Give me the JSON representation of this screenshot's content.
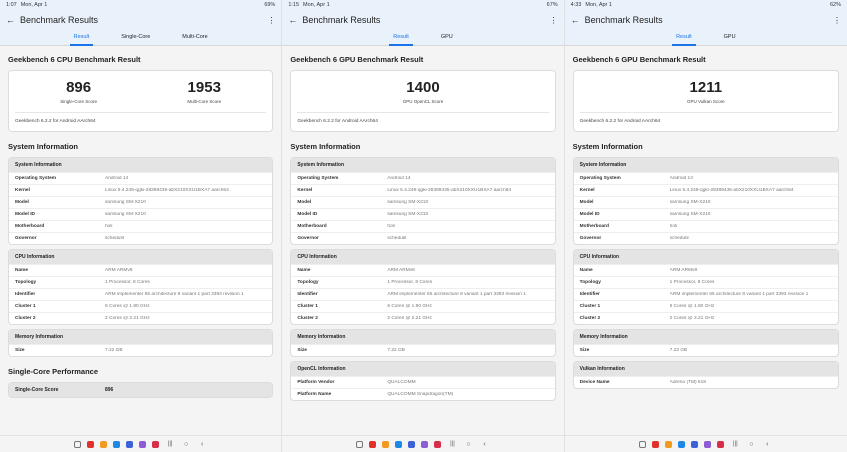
{
  "panes": [
    {
      "status": {
        "time": "1:07",
        "date": "Mon, Apr 1",
        "battery": "69%"
      },
      "title": "Benchmark Results",
      "tabs": [
        "Result",
        "Single-Core",
        "Multi-Core"
      ],
      "heading": "Geekbench 6 CPU Benchmark Result",
      "scores": [
        {
          "value": "896",
          "label": "Single-Core Score"
        },
        {
          "value": "1953",
          "label": "Multi-Core Score"
        }
      ],
      "version": "Geekbench 6.2.2 for Android AArch64",
      "section": "System Information",
      "cards": [
        {
          "title": "System Information",
          "rows": [
            [
              "Operating System",
              "Android 14"
            ],
            [
              "Kernel",
              "Linux 5.4.249-qgki-28389435-abX210XXU1BXA7 aarch64"
            ],
            [
              "Model",
              "samsung SM-X210"
            ],
            [
              "Model ID",
              "samsung SM-X210"
            ],
            [
              "Motherboard",
              "holi"
            ],
            [
              "Governor",
              "schedutil"
            ]
          ]
        },
        {
          "title": "CPU Information",
          "rows": [
            [
              "Name",
              "ARM ARMv8"
            ],
            [
              "Topology",
              "1 Processor, 8 Cores"
            ],
            [
              "Identifier",
              "ARM implementer 65 architecture 8 variant 1 part 3393 revision 1"
            ],
            [
              "Cluster 1",
              "6 Cores @ 1.80 GHz"
            ],
            [
              "Cluster 2",
              "2 Cores @ 2.21 GHz"
            ]
          ]
        },
        {
          "title": "Memory Information",
          "rows": [
            [
              "Size",
              "7.22 GB"
            ]
          ]
        }
      ],
      "section2": "Single-Core Performance",
      "cards2": [
        {
          "title": "Single-Core Score",
          "value": "896",
          "rows": []
        }
      ]
    },
    {
      "status": {
        "time": "1:15",
        "date": "Mon, Apr 1",
        "battery": "67%"
      },
      "title": "Benchmark Results",
      "tabs": [
        "Result",
        "GPU"
      ],
      "heading": "Geekbench 6 GPU Benchmark Result",
      "scores": [
        {
          "value": "1400",
          "label": "GPU OpenCL Score"
        }
      ],
      "version": "Geekbench 6.2.2 for Android AArch64",
      "section": "System Information",
      "cards": [
        {
          "title": "System Information",
          "rows": [
            [
              "Operating System",
              "Android 14"
            ],
            [
              "Kernel",
              "Linux 5.4.249-qgki-28389435-abX210XXU1BXA7 aarch64"
            ],
            [
              "Model",
              "samsung SM-X210"
            ],
            [
              "Model ID",
              "samsung SM-X210"
            ],
            [
              "Motherboard",
              "holi"
            ],
            [
              "Governor",
              "schedutil"
            ]
          ]
        },
        {
          "title": "CPU Information",
          "rows": [
            [
              "Name",
              "ARM ARMv8"
            ],
            [
              "Topology",
              "1 Processor, 8 Cores"
            ],
            [
              "Identifier",
              "ARM implementer 65 architecture 8 variant 1 part 3393 revision 1"
            ],
            [
              "Cluster 1",
              "6 Cores @ 1.80 GHz"
            ],
            [
              "Cluster 2",
              "2 Cores @ 2.21 GHz"
            ]
          ]
        },
        {
          "title": "Memory Information",
          "rows": [
            [
              "Size",
              "7.22 GB"
            ]
          ]
        },
        {
          "title": "OpenCL Information",
          "rows": [
            [
              "Platform Vendor",
              "QUALCOMM"
            ],
            [
              "Platform Name",
              "QUALCOMM Snapdragon(TM)"
            ]
          ]
        }
      ]
    },
    {
      "status": {
        "time": "4:33",
        "date": "Mon, Apr 1",
        "battery": "62%"
      },
      "title": "Benchmark Results",
      "tabs": [
        "Result",
        "GPU"
      ],
      "heading": "Geekbench 6 GPU Benchmark Result",
      "scores": [
        {
          "value": "1211",
          "label": "GPU Vulkan Score"
        }
      ],
      "version": "Geekbench 6.2.2 for Android AArch64",
      "section": "System Information",
      "cards": [
        {
          "title": "System Information",
          "rows": [
            [
              "Operating System",
              "Android 14"
            ],
            [
              "Kernel",
              "Linux 5.4.249-qgki-28389435-abX210XXU1BXA7 aarch64"
            ],
            [
              "Model",
              "samsung SM-X210"
            ],
            [
              "Model ID",
              "samsung SM-X210"
            ],
            [
              "Motherboard",
              "holi"
            ],
            [
              "Governor",
              "schedutil"
            ]
          ]
        },
        {
          "title": "CPU Information",
          "rows": [
            [
              "Name",
              "ARM ARMv8"
            ],
            [
              "Topology",
              "1 Processor, 8 Cores"
            ],
            [
              "Identifier",
              "ARM implementer 65 architecture 8 variant 1 part 3393 revision 1"
            ],
            [
              "Cluster 1",
              "6 Cores @ 1.80 GHz"
            ],
            [
              "Cluster 2",
              "2 Cores @ 2.21 GHz"
            ]
          ]
        },
        {
          "title": "Memory Information",
          "rows": [
            [
              "Size",
              "7.22 GB"
            ]
          ]
        },
        {
          "title": "Vulkan Information",
          "rows": [
            [
              "Device Name",
              "Adreno (TM) 619"
            ]
          ]
        }
      ]
    }
  ],
  "navbar": {
    "icons": [
      "apps-grid-icon",
      "phone-icon",
      "messages-icon",
      "contacts-icon",
      "chat-icon",
      "gallery-icon",
      "camera-icon"
    ],
    "icon_colors": [
      "#888888",
      "#e0322b",
      "#f29a1f",
      "#1e88e5",
      "#3b62d8",
      "#8e5bd6",
      "#d62f4a"
    ]
  }
}
